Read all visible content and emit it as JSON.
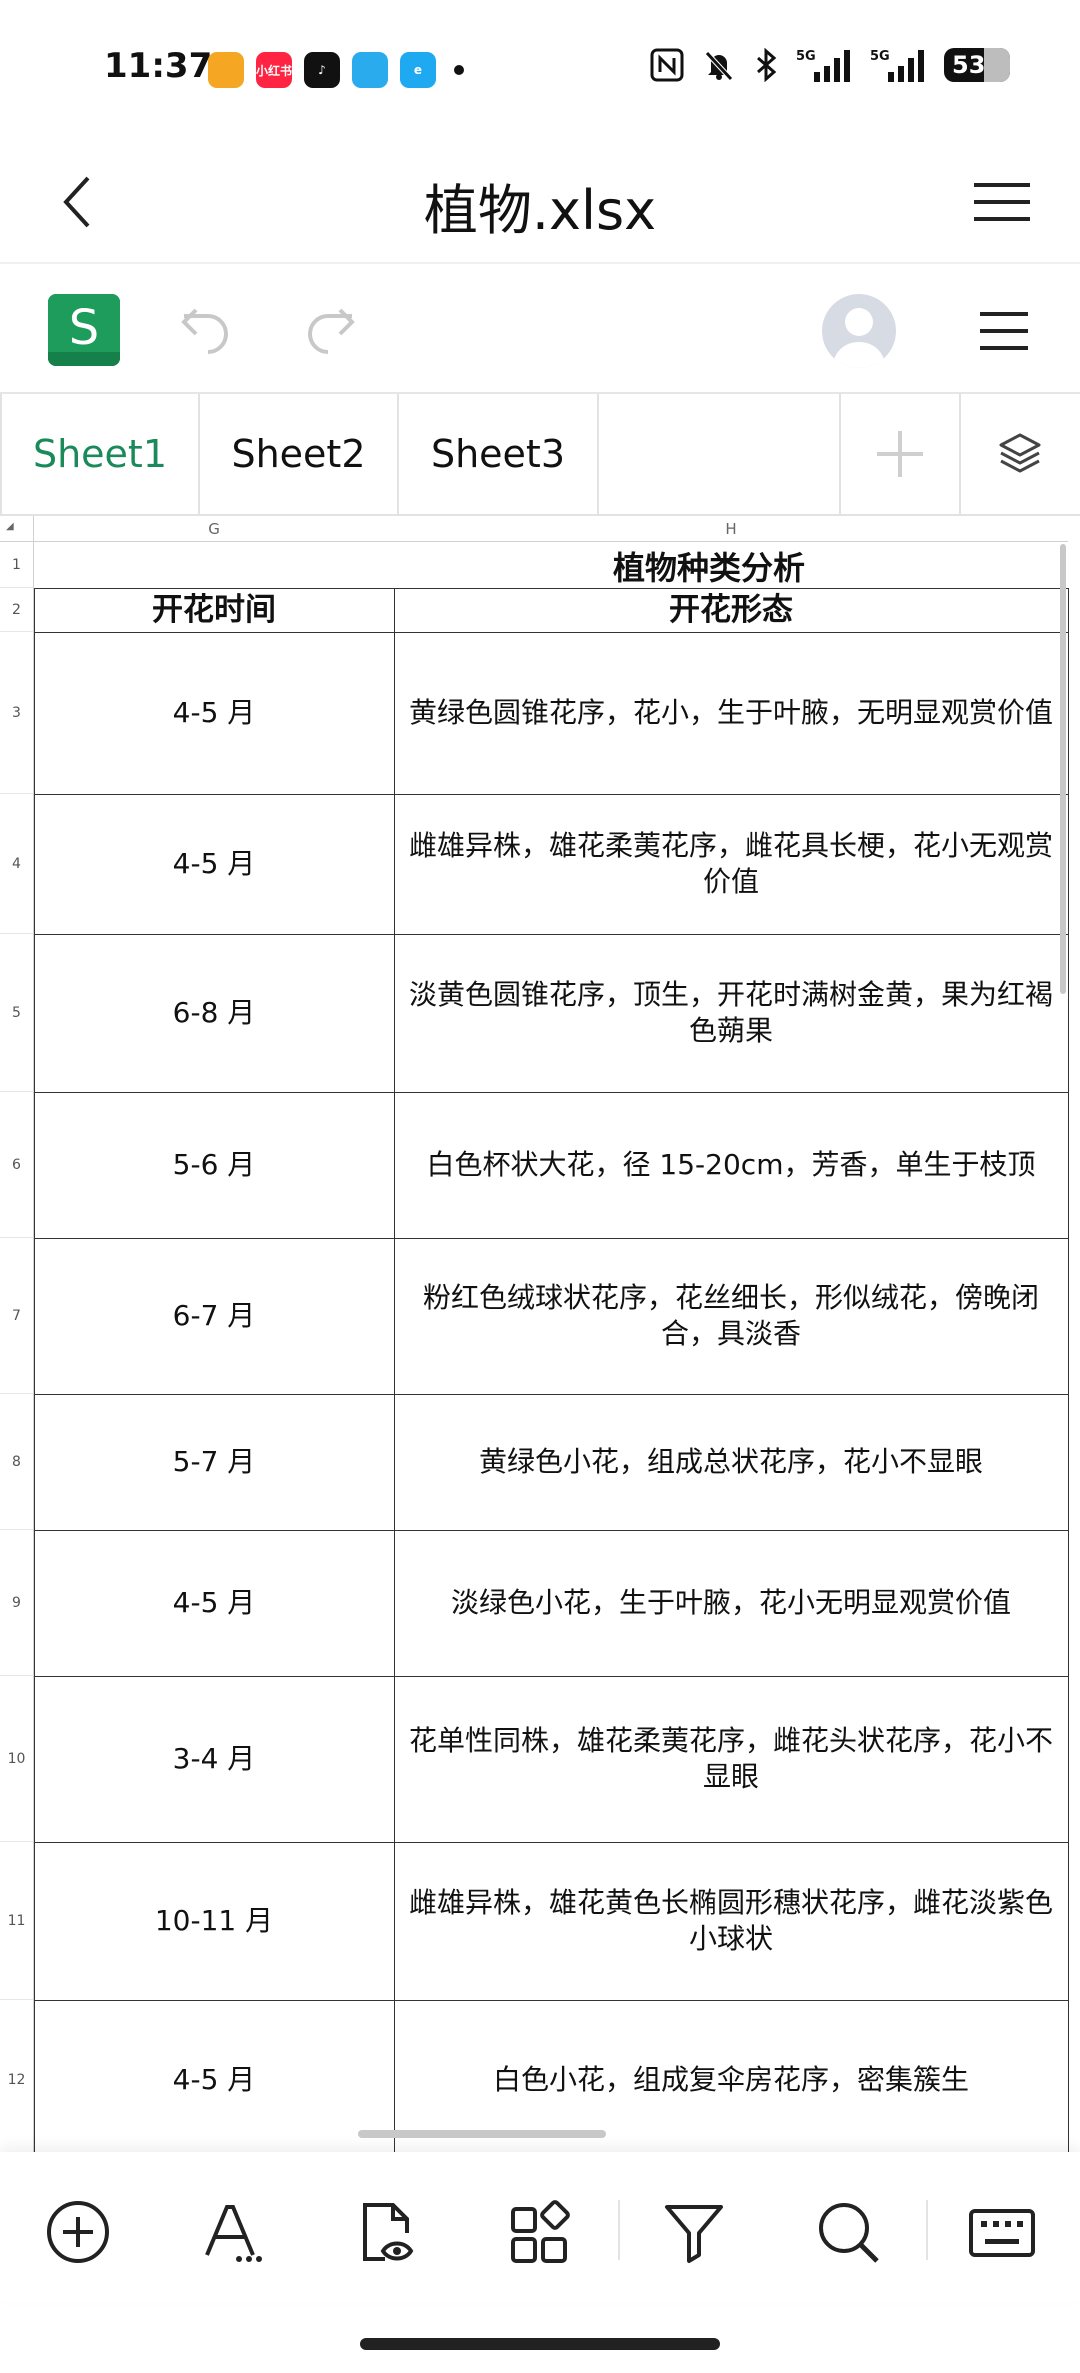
{
  "status_bar": {
    "time": "11:37",
    "battery": "53",
    "app_icons": [
      {
        "name": "wallet-app-icon",
        "label": "",
        "color": "#f5a623"
      },
      {
        "name": "xiaohongshu-app-icon",
        "label": "小红书",
        "color": "#ff2442"
      },
      {
        "name": "tiktok-app-icon",
        "label": "♪",
        "color": "#111111"
      },
      {
        "name": "telegram-app-icon",
        "label": "",
        "color": "#2aabee"
      },
      {
        "name": "browser-app-icon",
        "label": "e",
        "color": "#1fa9f0"
      }
    ]
  },
  "header": {
    "title": "植物.xlsx"
  },
  "tabs": {
    "items": [
      {
        "label": "Sheet1"
      },
      {
        "label": "Sheet2"
      },
      {
        "label": "Sheet3"
      }
    ],
    "active_index": 0
  },
  "grid": {
    "columns": [
      {
        "label": "G"
      },
      {
        "label": "H"
      }
    ],
    "title_row": {
      "row": "1",
      "text": "植物种类分析"
    },
    "header_row": {
      "row": "2",
      "col_g": "开花时间",
      "col_h": "开花形态"
    },
    "rows": [
      {
        "row": "3",
        "g": "4-5 月",
        "h": "黄绿色圆锥花序，花小，生于叶腋，无明显观赏价值"
      },
      {
        "row": "4",
        "g": "4-5 月",
        "h": "雌雄异株，雄花柔荑花序，雌花具长梗，花小无观赏价值"
      },
      {
        "row": "5",
        "g": "6-8 月",
        "h": "淡黄色圆锥花序，顶生，开花时满树金黄，果为红褐色蒴果"
      },
      {
        "row": "6",
        "g": "5-6 月",
        "h": "白色杯状大花，径 15-20cm，芳香，单生于枝顶"
      },
      {
        "row": "7",
        "g": "6-7 月",
        "h": "粉红色绒球状花序，花丝细长，形似绒花，傍晚闭合，具淡香"
      },
      {
        "row": "8",
        "g": "5-7 月",
        "h": "黄绿色小花，组成总状花序，花小不显眼"
      },
      {
        "row": "9",
        "g": "4-5 月",
        "h": "淡绿色小花，生于叶腋，花小无明显观赏价值"
      },
      {
        "row": "10",
        "g": "3-4 月",
        "h": "花单性同株，雄花柔荑花序，雌花头状花序，花小不显眼"
      },
      {
        "row": "11",
        "g": "10-11 月",
        "h": "雌雄异株，雄花黄色长椭圆形穗状花序，雌花淡紫色小球状"
      },
      {
        "row": "12",
        "g": "4-5 月",
        "h": "白色小花，组成复伞房花序，密集簇生"
      }
    ]
  },
  "colors": {
    "accent_green": "#1a8a5a",
    "sheet_logo": "#1e9c5b"
  }
}
